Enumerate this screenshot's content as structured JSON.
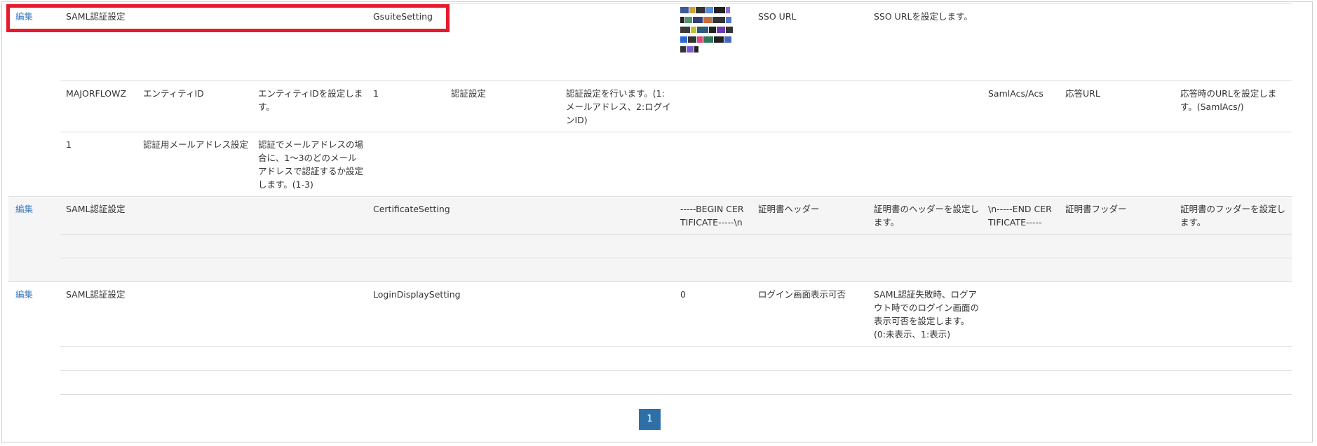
{
  "rows": [
    {
      "edit": "編集",
      "category": "SAML認証設定",
      "key": "GsuiteSetting",
      "value_label": "SSO URL",
      "value_desc": "SSO URLを設定します。",
      "sub1": {
        "group": "MAJORFLOWZ",
        "k1": "エンティティID",
        "d1": "エンティティIDを設定します。",
        "v2": "1",
        "k2": "認証設定",
        "d2": "認証設定を行います。(1:メールアドレス、2:ログインID)",
        "v3": "SamlAcs/Acs",
        "k3": "応答URL",
        "d3": "応答時のURLを設定します。(SamlAcs/)"
      },
      "sub2": {
        "v1": "1",
        "k1": "認証用メールアドレス設定",
        "d1": "認証でメールアドレスの場合に、1～3のどのメールアドレスで認証するか設定します。(1-3)"
      }
    },
    {
      "edit": "編集",
      "category": "SAML認証設定",
      "key": "CertificateSetting",
      "v1": "-----BEGIN CERTIFICATE-----\\n",
      "k1": "証明書ヘッダー",
      "d1": "証明書のヘッダーを設定します。",
      "v2": "\\n-----END CERTIFICATE-----",
      "k2": "証明書フッダー",
      "d2": "証明書のフッダーを設定します。"
    },
    {
      "edit": "編集",
      "category": "SAML認証設定",
      "key": "LoginDisplaySetting",
      "v1": "0",
      "k1": "ログイン画面表示可否",
      "d1": "SAML認証失敗時、ログアウト時でのログイン画面の表示可否を設定します。(0:未表示、1:表示)"
    }
  ],
  "pagination": {
    "current": "1"
  },
  "colors": {
    "link": "#3a7bbf",
    "highlight": "#e8192c",
    "pager": "#2f6fa8"
  },
  "icons": {
    "value_image": "blurred-image-icon"
  }
}
